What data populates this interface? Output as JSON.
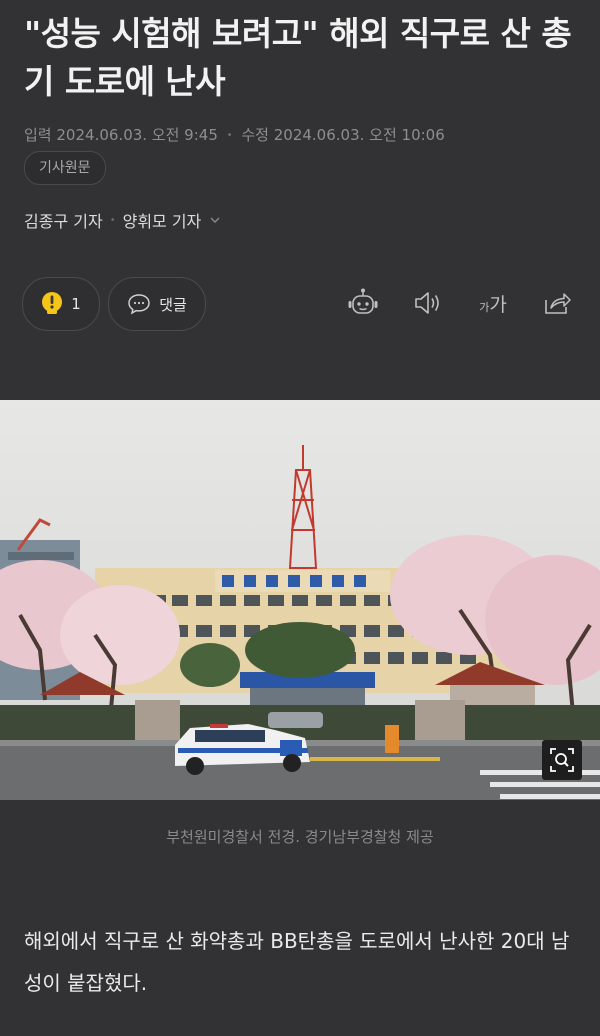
{
  "article": {
    "headline": "\"성능 시험해 보려고\" 해외 직구로 산 총기 도로에 난사",
    "published_label": "입력",
    "published": "2024.06.03. 오전 9:45",
    "modified_label": "수정",
    "modified": "2024.06.03. 오전 10:06",
    "original_button": "기사원문",
    "reporters": [
      "김종구 기자",
      "양휘모 기자"
    ],
    "body": "해외에서 직구로 산 화약총과 BB탄총을 도로에서 난사한 20대 남성이 붙잡혔다."
  },
  "actions": {
    "reaction_count": "1",
    "comment_label": "댓글",
    "font_size_label": "가가"
  },
  "photo": {
    "building_sign": "부천원미경찰서",
    "caption": "부천원미경찰서 전경. 경기남부경찰청 제공"
  },
  "colors": {
    "background": "#323234",
    "reaction_icon": "#f5c518",
    "text": "#eaeaea"
  },
  "icons": [
    "lightbulb-icon",
    "comment-bubble-icon",
    "robot-summary-icon",
    "speaker-icon",
    "share-icon",
    "chevron-down-icon",
    "zoom-icon"
  ]
}
